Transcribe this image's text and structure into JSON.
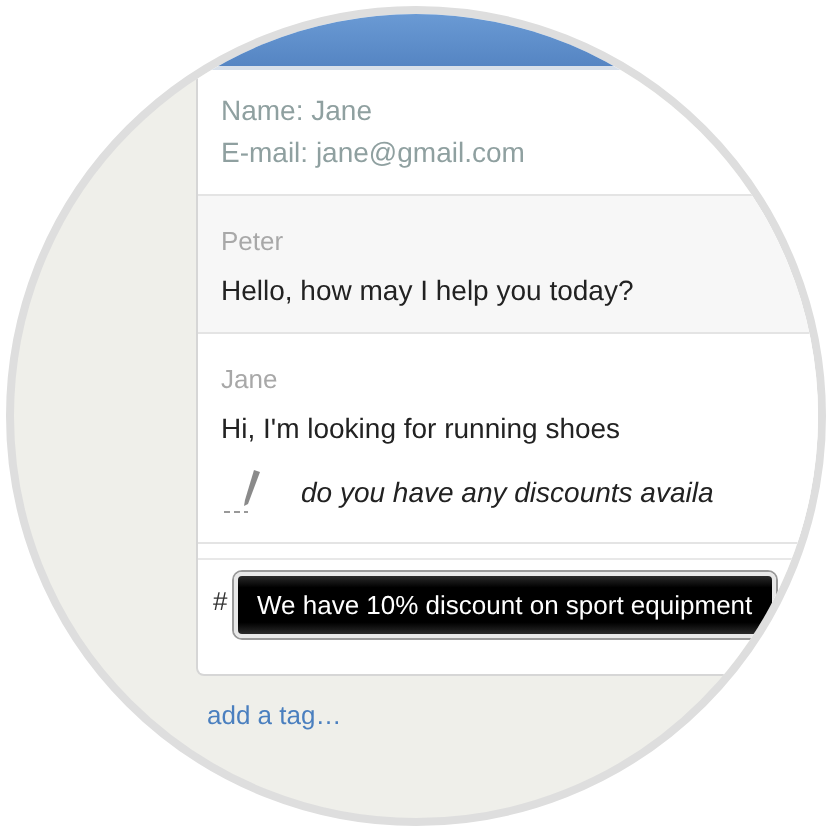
{
  "visitor": {
    "name": "Name: Jane",
    "email": "E-mail: jane@gmail.com"
  },
  "messages": [
    {
      "author": "Peter",
      "text": "Hello, how may I help you today?",
      "kind": "agent"
    },
    {
      "author": "Jane",
      "text": "Hi, I'm looking for running shoes",
      "kind": "visitor"
    }
  ],
  "typing": {
    "text": "do you have any discounts availa"
  },
  "reply_field": {
    "value": "#"
  },
  "tooltip": {
    "text": "We have 10% discount on sport equipment"
  },
  "add_tag_link": "add a tag…"
}
